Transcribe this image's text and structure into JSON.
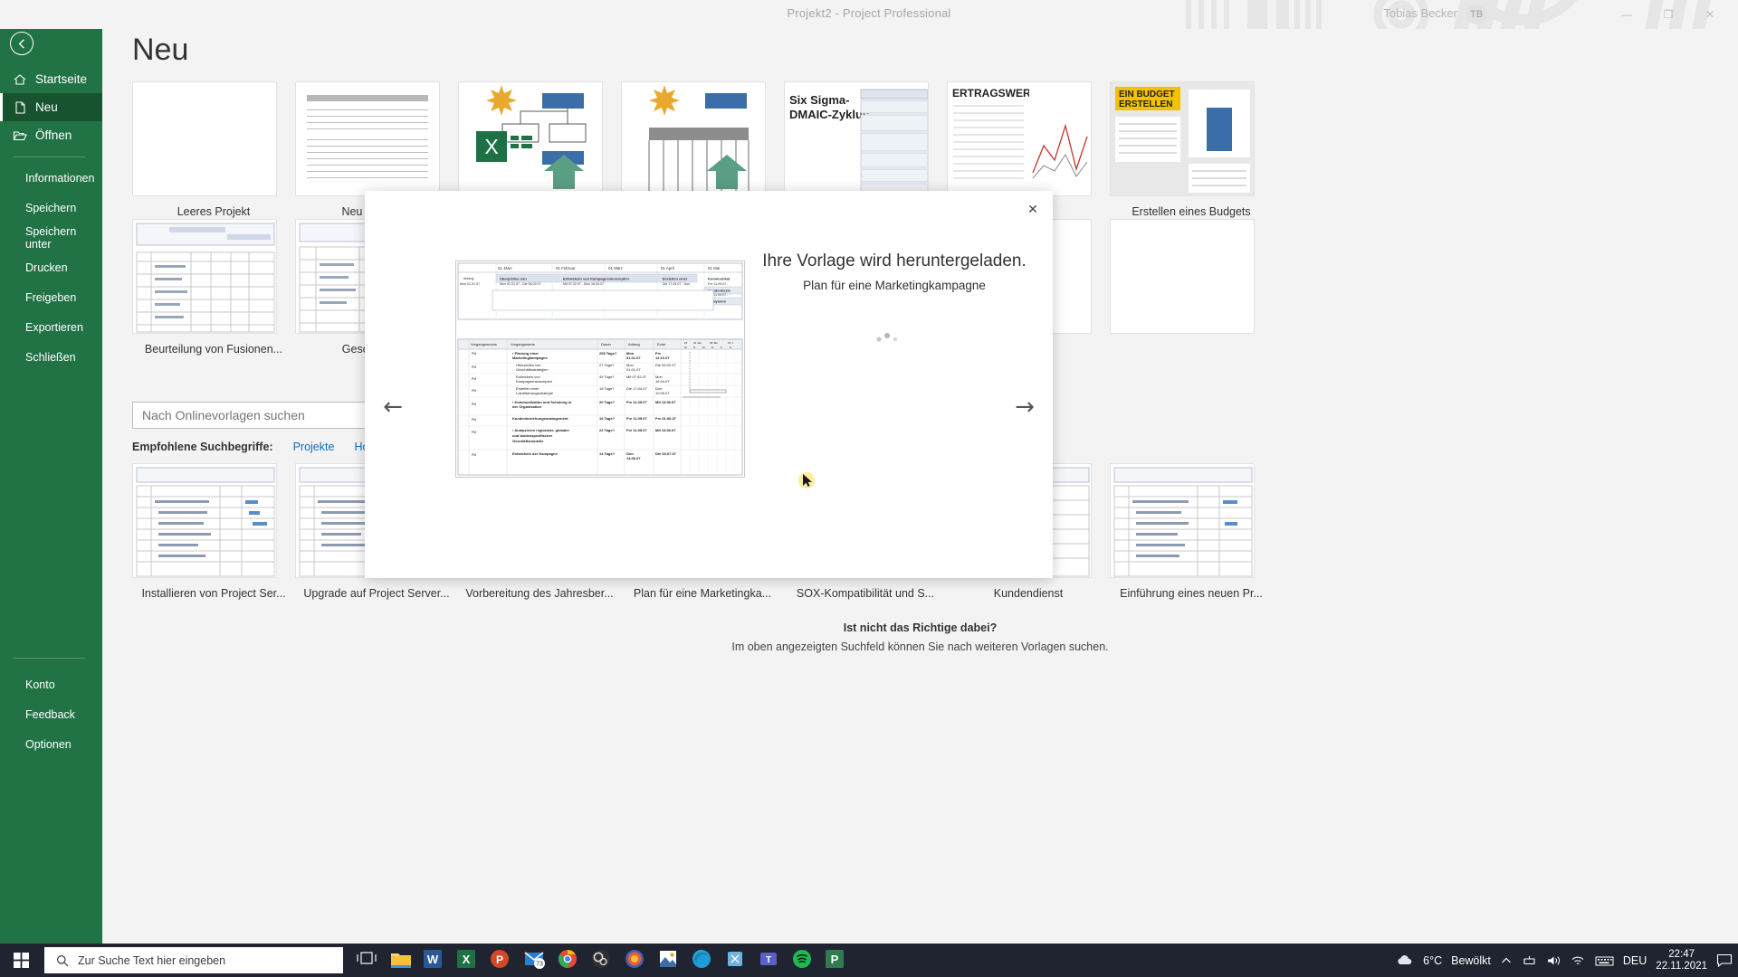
{
  "titlebar": {
    "title": "Projekt2  -  Project Professional",
    "user": "Tobias Becker",
    "avatar_initials": "TB",
    "minimize": "—",
    "restore": "❐",
    "close": "✕"
  },
  "sidebar": {
    "back_icon": "back-arrow-icon",
    "top_items": [
      {
        "label": "Startseite",
        "icon": "home-icon",
        "active": false
      },
      {
        "label": "Neu",
        "icon": "document-icon",
        "active": true
      },
      {
        "label": "Öffnen",
        "icon": "folder-open-icon",
        "active": false
      }
    ],
    "mid_items": [
      {
        "label": "Informationen"
      },
      {
        "label": "Speichern"
      },
      {
        "label": "Speichern unter"
      },
      {
        "label": "Drucken"
      },
      {
        "label": "Freigeben"
      },
      {
        "label": "Exportieren"
      },
      {
        "label": "Schließen"
      }
    ],
    "bottom_items": [
      {
        "label": "Konto"
      },
      {
        "label": "Feedback"
      },
      {
        "label": "Optionen"
      }
    ],
    "accent_color": "#217346",
    "active_color": "#17532f"
  },
  "main": {
    "page_title": "Neu",
    "rows": [
      {
        "tiles": [
          {
            "label": "Leeres Projekt",
            "art": "blank"
          },
          {
            "label": "Neu aus vor...",
            "art": "lines"
          },
          {
            "label": "",
            "art": "excel-import"
          },
          {
            "label": "",
            "art": "sharepoint-import"
          },
          {
            "label": "",
            "art": "sixsigma"
          },
          {
            "label": "",
            "art": "ertragswert"
          },
          {
            "label": "Erstellen eines Budgets",
            "art": "budget"
          }
        ]
      },
      {
        "tiles": [
          {
            "label": "Beurteilung von Fusionen...",
            "art": "gantt"
          },
          {
            "label": "Geschäftspl...",
            "art": "gantt"
          },
          {
            "label": "",
            "art": "gantt"
          },
          {
            "label": "",
            "art": "gantt"
          },
          {
            "label": "",
            "art": "gantt"
          },
          {
            "label": "",
            "art": "gantt"
          },
          {
            "label": "",
            "art": "gantt"
          }
        ]
      },
      {
        "tiles": [
          {
            "label": "Installieren von Project Ser...",
            "art": "gantt"
          },
          {
            "label": "Upgrade auf Project Server...",
            "art": "gantt"
          },
          {
            "label": "Vorbereitung des Jahresber...",
            "art": "gantt"
          },
          {
            "label": "Plan für eine Marketingka...",
            "art": "gantt"
          },
          {
            "label": "SOX-Kompatibilität und S...",
            "art": "gantt"
          },
          {
            "label": "Kundendienst",
            "art": "gantt"
          },
          {
            "label": "Einführung eines neuen Pr...",
            "art": "gantt"
          }
        ]
      }
    ],
    "search": {
      "placeholder": "Nach Onlinevorlagen suchen",
      "value": "",
      "icon": "search-icon"
    },
    "suggestions_label": "Empfohlene Suchbegriffe:",
    "suggestions": [
      "Projekte",
      "Hochschultools"
    ],
    "footnote_title": "Ist nicht das Richtige dabei?",
    "footnote_text": "Im oben angezeigten Suchfeld können Sie nach weiteren Vorlagen suchen."
  },
  "modal": {
    "close_icon": "close-icon",
    "prev_icon": "arrow-left-icon",
    "next_icon": "arrow-right-icon",
    "prev_glyph": "←",
    "next_glyph": "→",
    "close_glyph": "✕",
    "heading": "Ihre Vorlage wird heruntergeladen.",
    "subtitle": "Plan für eine Marketingkampagne",
    "preview_name": "marketing-campaign-gantt-preview",
    "preview_rows": [
      {
        "name": "Planung einer Marketingkampagne",
        "duration": "205 Tage?",
        "start": "Mon 01.01.07",
        "finish": "Fre 12.10.07"
      },
      {
        "name": "Überprüfen von Geschäftsstrategien",
        "duration": "27 Tage?",
        "start": "Mon 01.01.07",
        "finish": "Die 06.02.07"
      },
      {
        "name": "Entwickeln von Kampagnenkonzepten",
        "duration": "49 Tage?",
        "start": "Mit 07.02.07",
        "finish": "Mon 16.04.07"
      },
      {
        "name": "Erstellen einer Lokalisierungsstrategie",
        "duration": "18 Tage?",
        "start": "Die 17.04.07",
        "finish": "Don 10.05.07"
      },
      {
        "name": "Kommunikation und Schulung in der Organisation",
        "duration": "20 Tage?",
        "start": "Fre 11.05.07",
        "finish": "Mit 13.06.07"
      },
      {
        "name": "Kundenbeziehungsmanagement",
        "duration": "16 Tage?",
        "start": "Fre 11.05.07",
        "finish": "Fre 01.06.07"
      },
      {
        "name": "Analysieren regionaler, globaler und landesspezifischer Geschäftsmodelle",
        "duration": "22 Tage?",
        "start": "Fre 11.05.07",
        "finish": "Mit 13.06.07"
      },
      {
        "name": "Entwickeln der Kampagne",
        "duration": "14 Tage?",
        "start": "Don 14.06.07",
        "finish": "Die 03.07.07"
      }
    ],
    "timeline_labels": [
      "01 Jänn",
      "01 Februar",
      "01 März",
      "01 April",
      "01 Mai"
    ],
    "timeline_bars": [
      "Überprüfen von Geschäftsstrategien",
      "Entwickeln von Kampagnenkonzepten",
      "Erstellen einer Lokalisierungsstrategie",
      "Kommunikation und Schulung",
      "Kundenbeziehung",
      "Analysieren"
    ],
    "column_headers": [
      "Vorgangsmodus",
      "Vorgangsname",
      "Dauer",
      "Anfang",
      "Ende"
    ]
  },
  "taskbar": {
    "start_icon": "windows-start-icon",
    "search_placeholder": "Zur Suche Text hier eingeben",
    "search_icon": "search-icon",
    "taskview_icon": "task-view-icon",
    "apps": [
      {
        "name": "file-explorer-icon",
        "glyph": ""
      },
      {
        "name": "word-icon",
        "glyph": "W"
      },
      {
        "name": "excel-icon",
        "glyph": "X"
      },
      {
        "name": "powerpoint-icon",
        "glyph": "P"
      },
      {
        "name": "outlook-icon",
        "glyph": "",
        "badge": "73"
      },
      {
        "name": "chrome-icon",
        "glyph": ""
      },
      {
        "name": "obs-icon",
        "glyph": ""
      },
      {
        "name": "firefox-icon",
        "glyph": ""
      },
      {
        "name": "photos-icon",
        "glyph": ""
      },
      {
        "name": "edge-icon",
        "glyph": ""
      },
      {
        "name": "snipping-tool-icon",
        "glyph": ""
      },
      {
        "name": "teams-icon",
        "glyph": ""
      },
      {
        "name": "spotify-icon",
        "glyph": ""
      },
      {
        "name": "project-icon",
        "glyph": "P"
      }
    ],
    "tray": {
      "weather_icon": "cloud-icon",
      "temperature": "6°C",
      "weather_text": "Bewölkt",
      "chevron_icon": "chevron-up-icon",
      "onedrive_icon": "onedrive-icon",
      "volume_icon": "speaker-icon",
      "network_icon": "wifi-icon",
      "keyboard_icon": "keyboard-icon",
      "language": "DEU",
      "time": "22:47",
      "date": "22.11.2021",
      "notification_icon": "notification-icon"
    }
  }
}
